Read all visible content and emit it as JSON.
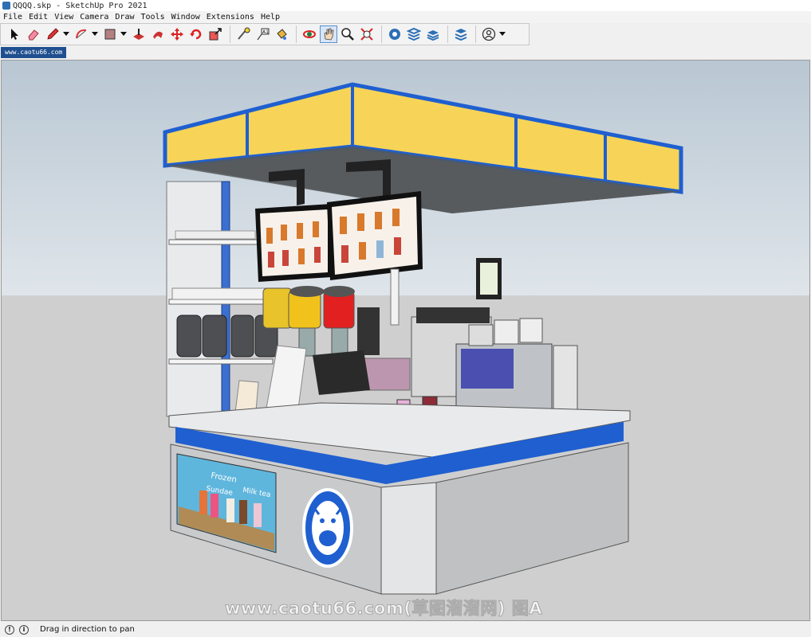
{
  "window": {
    "title": "QQQQ.skp - SketchUp Pro 2021"
  },
  "menubar": {
    "items": [
      "File",
      "Edit",
      "View",
      "Camera",
      "Draw",
      "Tools",
      "Window",
      "Extensions",
      "Help"
    ]
  },
  "toolbar": {
    "icons": [
      "select-icon",
      "eraser-icon",
      "pencil-icon",
      "arc-icon",
      "rectangle-icon",
      "push-pull-icon",
      "follow-me-icon",
      "move-icon",
      "rotate-icon",
      "scale-icon",
      "tape-measure-icon",
      "text-icon",
      "paint-bucket-icon",
      "orbit-icon",
      "pan-icon",
      "zoom-icon",
      "zoom-extents-icon",
      "warehouse-icon",
      "extension-warehouse-icon",
      "layout-icon",
      "send-to-layout-icon",
      "account-icon"
    ],
    "active": "pan-icon"
  },
  "tab": {
    "label": "www.caotu66.com"
  },
  "viewport": {
    "sky_color": "#c9d4dd",
    "ground_color": "#cfcfcf",
    "model": "kiosk",
    "kiosk": {
      "side_poster_words": [
        "Frozen",
        "Sundae",
        "Milk tea"
      ]
    },
    "watermark": "www.caotu66.com(草图溜溜网) 图A"
  },
  "statusbar": {
    "hint_icon": "info-icon",
    "message": "Drag in direction to pan"
  },
  "colors": {
    "accent_blue": "#1f5fd0",
    "canopy_yellow": "#f7d458",
    "tab_blue": "#1f4f8f"
  }
}
